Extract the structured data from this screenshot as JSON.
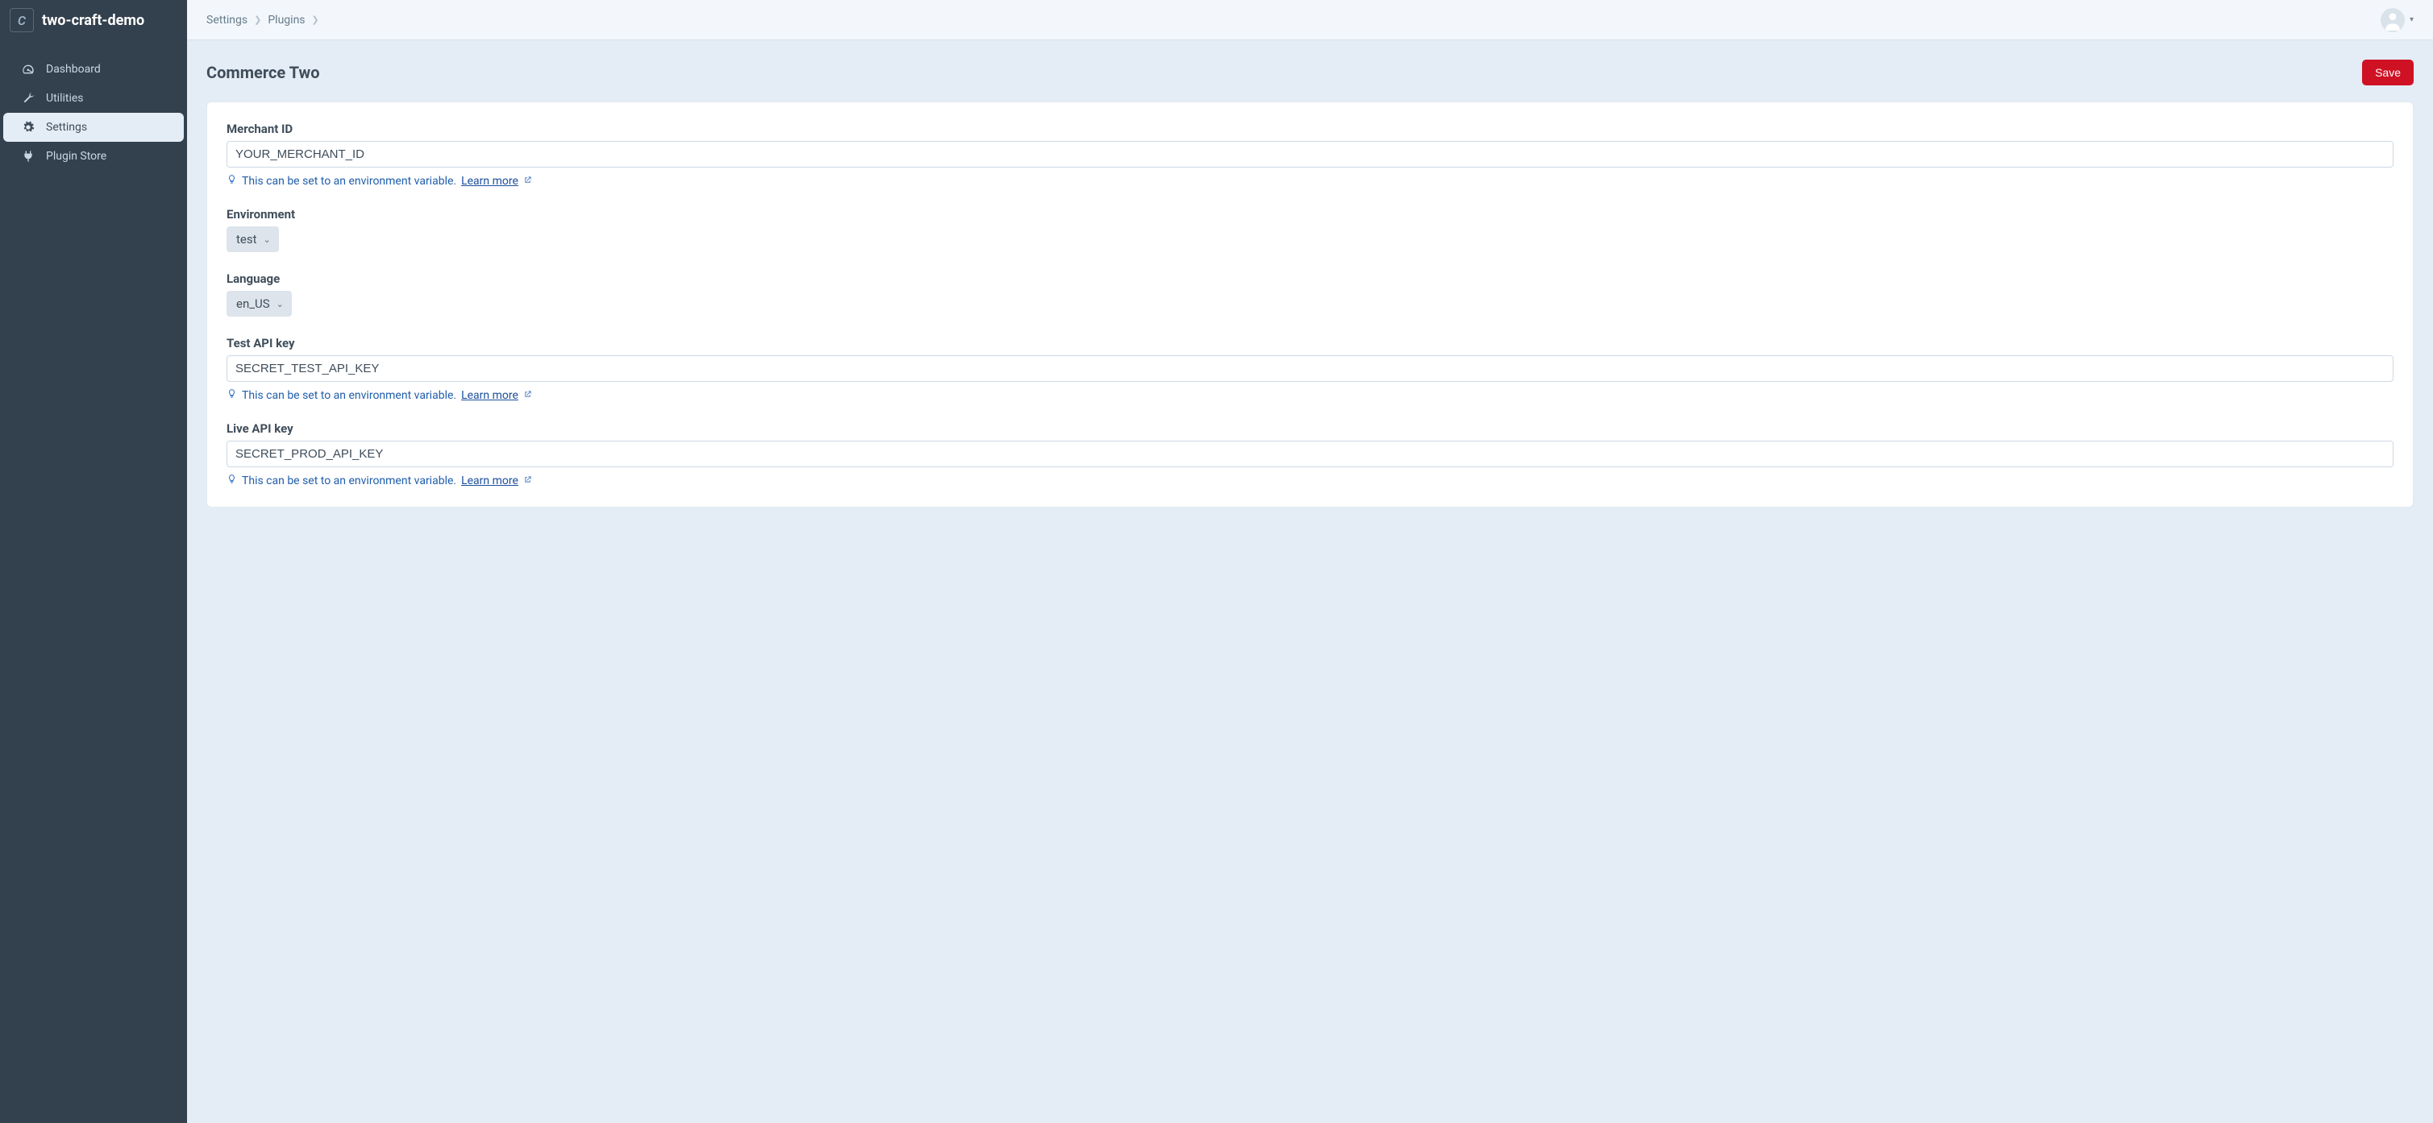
{
  "site": {
    "name": "two-craft-demo",
    "logo_letter": "C"
  },
  "nav": {
    "items": [
      {
        "label": "Dashboard"
      },
      {
        "label": "Utilities"
      },
      {
        "label": "Settings"
      },
      {
        "label": "Plugin Store"
      }
    ]
  },
  "breadcrumbs": {
    "items": [
      {
        "label": "Settings"
      },
      {
        "label": "Plugins"
      }
    ]
  },
  "header": {
    "title": "Commerce Two",
    "save_label": "Save"
  },
  "tip": {
    "text": "This can be set to an environment variable.",
    "learn_more": "Learn more"
  },
  "fields": {
    "merchant_id": {
      "label": "Merchant ID",
      "value": "YOUR_MERCHANT_ID"
    },
    "environment": {
      "label": "Environment",
      "value": "test"
    },
    "language": {
      "label": "Language",
      "value": "en_US"
    },
    "test_api_key": {
      "label": "Test API key",
      "value": "SECRET_TEST_API_KEY"
    },
    "live_api_key": {
      "label": "Live API key",
      "value": "SECRET_PROD_API_KEY"
    }
  }
}
